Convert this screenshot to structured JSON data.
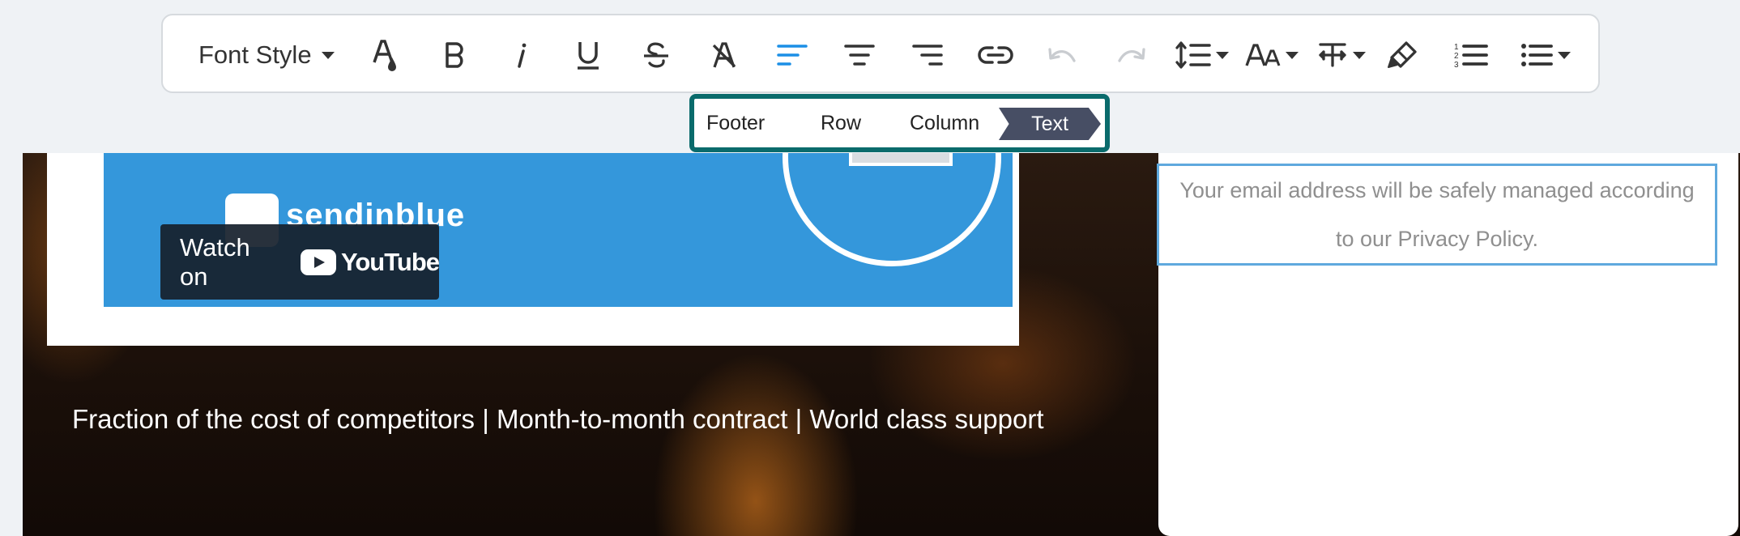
{
  "toolbar": {
    "font_style_label": "Font Style",
    "buttons": [
      {
        "name": "text-color-button",
        "icon": "text-color-icon"
      },
      {
        "name": "bold-button",
        "icon": "bold-icon"
      },
      {
        "name": "italic-button",
        "icon": "italic-icon"
      },
      {
        "name": "underline-button",
        "icon": "underline-icon"
      },
      {
        "name": "strikethrough-button",
        "icon": "strikethrough-icon"
      },
      {
        "name": "clear-format-button",
        "icon": "clear-format-icon"
      },
      {
        "name": "align-left-button",
        "icon": "align-left-icon",
        "active": true
      },
      {
        "name": "align-center-button",
        "icon": "align-center-icon"
      },
      {
        "name": "align-right-button",
        "icon": "align-right-icon"
      },
      {
        "name": "link-button",
        "icon": "link-icon"
      },
      {
        "name": "undo-button",
        "icon": "undo-icon",
        "disabled": true
      },
      {
        "name": "redo-button",
        "icon": "redo-icon",
        "disabled": true
      },
      {
        "name": "line-height-button",
        "icon": "line-height-icon"
      },
      {
        "name": "font-size-button",
        "icon": "font-size-icon"
      },
      {
        "name": "letter-spacing-button",
        "icon": "letter-spacing-icon"
      },
      {
        "name": "highlight-button",
        "icon": "highlight-icon"
      },
      {
        "name": "ordered-list-button",
        "icon": "ordered-list-icon"
      },
      {
        "name": "unordered-list-button",
        "icon": "unordered-list-icon"
      }
    ]
  },
  "breadcrumb": {
    "items": [
      "Footer",
      "Row",
      "Column"
    ],
    "active": "Text"
  },
  "video": {
    "brand": "sendinblue",
    "watch_on": "Watch on",
    "platform": "YouTube"
  },
  "content": {
    "tagline": "Fraction of the cost of competitors | Month-to-month contract | World class support",
    "privacy_text": "Your email address will be safely managed according to our Privacy Policy."
  },
  "colors": {
    "accent_blue": "#1b8fe6",
    "breadcrumb_border": "#0a6b6c",
    "breadcrumb_active": "#474e64",
    "video_blue": "#3497db",
    "selection_border": "#5fa9de"
  }
}
